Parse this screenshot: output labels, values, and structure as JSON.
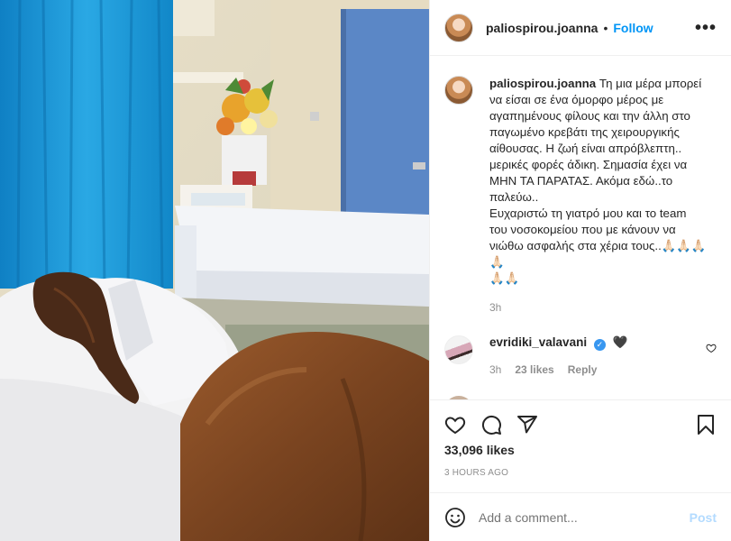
{
  "post": {
    "username": "paliospirou.joanna",
    "follow_label": "Follow",
    "separator": "•",
    "more_label": "•••",
    "caption_lines": [
      "Τη μια μέρα μπορεί",
      "να είσαι σε ένα όμορφο μέρος με",
      "αγαπημένους φίλους και την άλλη στο",
      "παγωμένο κρεβάτι της χειρουργικής",
      "αίθουσας. Η ζωή είναι απρόβλεπτη..",
      "μερικές φορές άδικη. Σημασία έχει να",
      "ΜΗΝ ΤΑ ΠΑΡΑΤΑΣ. Ακόμα εδώ..το",
      "παλεύω..",
      "Ευχαριστώ τη γιατρό μου και το team",
      "του νοσοκομείου που με κάνουν να",
      "νιώθω ασφαλής στα χέρια τους..🙏🏻🙏🏻🙏🏻🙏🏻",
      "🙏🏻🙏🏻"
    ],
    "caption_age": "3h"
  },
  "comments": [
    {
      "username": "evridiki_valavani",
      "text": "🖤",
      "age": "3h",
      "likes": "23 likes",
      "reply_label": "Reply"
    }
  ],
  "cut_comment_fragment": "................ ✔ 🌹",
  "stats": {
    "likes": "33,096 likes",
    "time_ago": "3 HOURS AGO"
  },
  "composer": {
    "placeholder": "Add a comment...",
    "post_label": "Post"
  },
  "icons": [
    "heart-icon",
    "comment-icon",
    "share-icon",
    "bookmark-icon",
    "emoji-icon",
    "more-icon",
    "verified-icon"
  ],
  "colors": {
    "link_blue": "#0095f6",
    "post_disabled": "#b3dbff",
    "muted": "#8e8e8e",
    "text": "#262626",
    "curtain": "#1e9ad6"
  }
}
